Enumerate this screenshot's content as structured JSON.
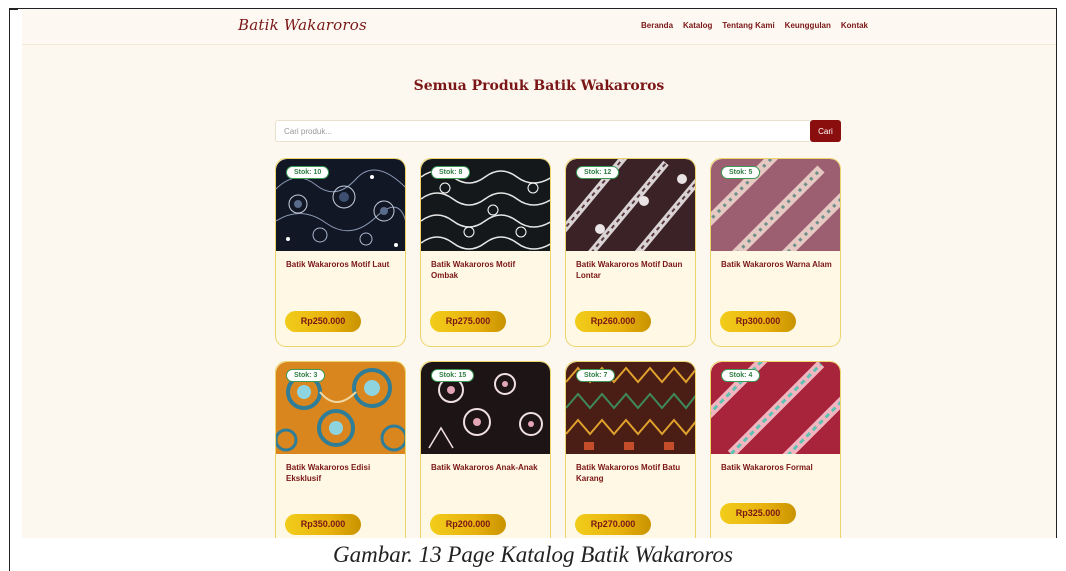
{
  "header": {
    "logo": "Batik Wakaroros",
    "nav": [
      "Beranda",
      "Katalog",
      "Tentang Kami",
      "Keunggulan",
      "Kontak"
    ]
  },
  "page": {
    "title": "Semua Produk Batik Wakaroros"
  },
  "search": {
    "placeholder": "Cari produk...",
    "value": "",
    "button_label": "Cari"
  },
  "products": [
    {
      "stock": "Stok: 10",
      "name": "Batik Wakaroros Motif Laut",
      "price": "Rp250.000",
      "pattern": "dark-navy-floral"
    },
    {
      "stock": "Stok: 8",
      "name": "Batik Wakaroros Motif Ombak",
      "price": "Rp275.000",
      "pattern": "black-white-waves"
    },
    {
      "stock": "Stok: 12",
      "name": "Batik Wakaroros Motif Daun Lontar",
      "price": "Rp260.000",
      "pattern": "brown-diagonal-leaves"
    },
    {
      "stock": "Stok: 5",
      "name": "Batik Wakaroros Warna Alam",
      "price": "Rp300.000",
      "pattern": "mauve-diagonal-stripes"
    },
    {
      "stock": "Stok: 3",
      "name": "Batik Wakaroros Edisi Eksklusif",
      "price": "Rp350.000",
      "pattern": "orange-blue-swirls"
    },
    {
      "stock": "Stok: 15",
      "name": "Batik Wakaroros Anak-Anak",
      "price": "Rp200.000",
      "pattern": "black-pink-florals"
    },
    {
      "stock": "Stok: 7",
      "name": "Batik Wakaroros Motif Batu Karang",
      "price": "Rp270.000",
      "pattern": "dark-red-green-tribal"
    },
    {
      "stock": "Stok: 4",
      "name": "Batik Wakaroros Formal",
      "price": "Rp325.000",
      "pattern": "red-pastel-diagonals"
    }
  ],
  "caption": "Gambar. 13 Page Katalog Batik Wakaroros",
  "colors": {
    "brand": "#7a1616",
    "button": "#8b0e0e",
    "background": "#fdf8ef",
    "card": "#fff8e4",
    "card_border": "#ecd46a",
    "price_gold": "#e7b10e",
    "stock_green": "#2e7d43"
  }
}
